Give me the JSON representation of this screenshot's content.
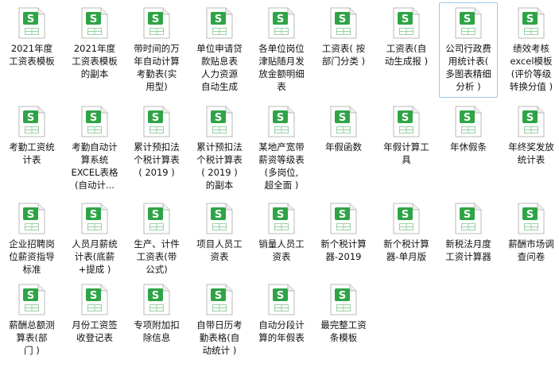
{
  "accent_color": "#2fa446",
  "icon": "spreadsheet-file-icon",
  "icon_letter": "S",
  "files": [
    {
      "label": "2021年度\n工资表模板"
    },
    {
      "label": "2021年度\n工资表模板\n的副本"
    },
    {
      "label": "带时间的万\n年自动计算\n考勤表(实\n用型)"
    },
    {
      "label": "单位申请贷\n款贴息表\n人力资源\n自动生成"
    },
    {
      "label": "各单位岗位\n津贴随月发\n放金额明细\n表"
    },
    {
      "label": "工资表( 按\n部门分类 )"
    },
    {
      "label": "工资表(自\n动生成报 )"
    },
    {
      "label": "公司行政费\n用统计表(\n多图表精细\n分析 )",
      "selected": true
    },
    {
      "label": "绩效考核\nexcel模板\n(评价等级\n转换分值 )"
    },
    {
      "label": "考勤工资统\n计表"
    },
    {
      "label": "考勤自动计\n算系统\nEXCEL表格\n(自动计..."
    },
    {
      "label": "累计预扣法\n个税计算表\n( 2019 )"
    },
    {
      "label": "累计预扣法\n个税计算表\n( 2019 )\n的副本"
    },
    {
      "label": "某地产宽带\n薪资等级表\n(多岗位,\n超全面 )"
    },
    {
      "label": "年假函数"
    },
    {
      "label": "年假计算工\n具"
    },
    {
      "label": "年休假条"
    },
    {
      "label": "年终奖发放\n统计表"
    },
    {
      "label": "企业招聘岗\n位薪资指导\n标准"
    },
    {
      "label": "人员月薪统\n计表(底薪\n+提成 )"
    },
    {
      "label": "生产、计件\n工资表(带\n公式)"
    },
    {
      "label": "项目人员工\n资表"
    },
    {
      "label": "销量人员工\n资表"
    },
    {
      "label": "新个税计算\n器-2019"
    },
    {
      "label": "新个税计算\n器-单月版"
    },
    {
      "label": "新税法月度\n工资计算器"
    },
    {
      "label": "薪酬市场调\n查问卷"
    },
    {
      "label": "薪酬总额测\n算表(部\n门 )"
    },
    {
      "label": "月份工资签\n收登记表"
    },
    {
      "label": "专项附加扣\n除信息"
    },
    {
      "label": "自带日历考\n勤表格(自\n动统计 )"
    },
    {
      "label": "自动分段计\n算的年假表"
    },
    {
      "label": "最完整工资\n条模板"
    }
  ]
}
